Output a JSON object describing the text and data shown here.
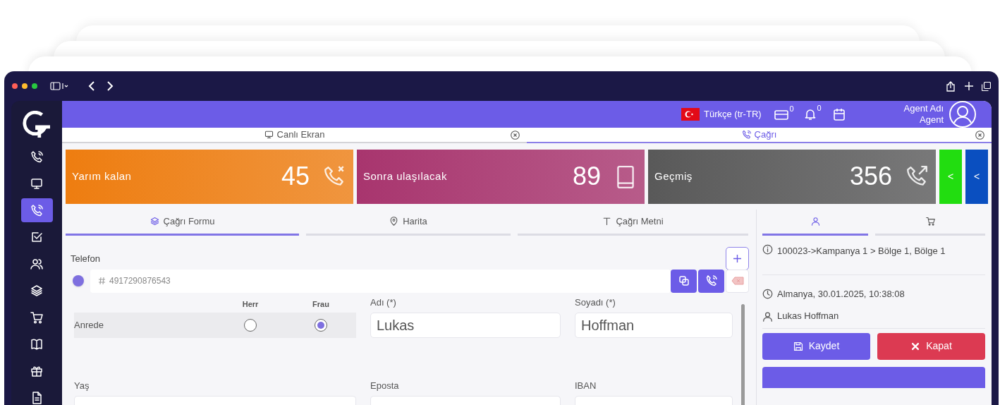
{
  "sidebar": {
    "items": [
      {
        "kind": "phone-wave",
        "selected": false
      },
      {
        "kind": "monitor",
        "selected": false
      },
      {
        "kind": "phone-wave",
        "selected": true
      },
      {
        "kind": "checkbox",
        "selected": false
      },
      {
        "kind": "users",
        "selected": false
      },
      {
        "kind": "layers",
        "selected": false
      },
      {
        "kind": "cart",
        "selected": false
      },
      {
        "kind": "book",
        "selected": false
      },
      {
        "kind": "gift",
        "selected": false
      },
      {
        "kind": "document",
        "selected": false
      }
    ]
  },
  "header": {
    "language": "Türkçe (tr-TR)",
    "wallet_count": "0",
    "notification_count": "0",
    "user_name": "Agent Adı",
    "user_role": "Agent"
  },
  "page_tabs": [
    {
      "label": "Canlı Ekran",
      "kind": "monitor",
      "selected": false
    },
    {
      "label": "Çağrı",
      "kind": "phone",
      "selected": true
    }
  ],
  "stats": [
    {
      "label": "Yarım kalan",
      "value": "45",
      "kind": "missed",
      "color": "#ee7d10"
    },
    {
      "label": "Sonra ulaşılacak",
      "value": "89",
      "kind": "later",
      "color": "#a8356e"
    },
    {
      "label": "Geçmiş",
      "value": "356",
      "kind": "history",
      "color": "#595959"
    }
  ],
  "stat_buttons": [
    {
      "label": "<",
      "color": "#22dd10"
    },
    {
      "label": "<",
      "color": "#0a4fc0"
    }
  ],
  "form_tabs": [
    {
      "label": "Çağrı Formu",
      "kind": "layers",
      "selected": true
    },
    {
      "label": "Harita",
      "kind": "pin",
      "selected": false
    },
    {
      "label": "Çağrı Metni",
      "kind": "text",
      "selected": false
    }
  ],
  "form": {
    "phone_label": "Telefon",
    "phone": "4917290876543",
    "salutation": {
      "label": "Anrede",
      "options": [
        {
          "label": "Herr",
          "selected": false
        },
        {
          "label": "Frau",
          "selected": true
        }
      ]
    },
    "fields": [
      {
        "label": "Adı (*)",
        "value": "Lukas"
      },
      {
        "label": "Soyadı (*)",
        "value": "Hoffman"
      }
    ],
    "more_labels": [
      "Yaş",
      "Eposta",
      "IBAN"
    ]
  },
  "side_tabs": [
    {
      "kind": "person",
      "selected": true
    },
    {
      "kind": "cart",
      "selected": false
    }
  ],
  "info": [
    {
      "kind": "info",
      "text": "100023->Kampanya 1 > Bölge 1, Bölge 1"
    },
    {
      "kind": "clock",
      "text": "Almanya, 30.01.2025, 10:38:08"
    },
    {
      "kind": "person",
      "text": "Lukas Hoffman"
    }
  ],
  "actions": [
    {
      "label": "Kaydet",
      "kind": "save"
    },
    {
      "label": "Kapat",
      "kind": "close"
    }
  ]
}
